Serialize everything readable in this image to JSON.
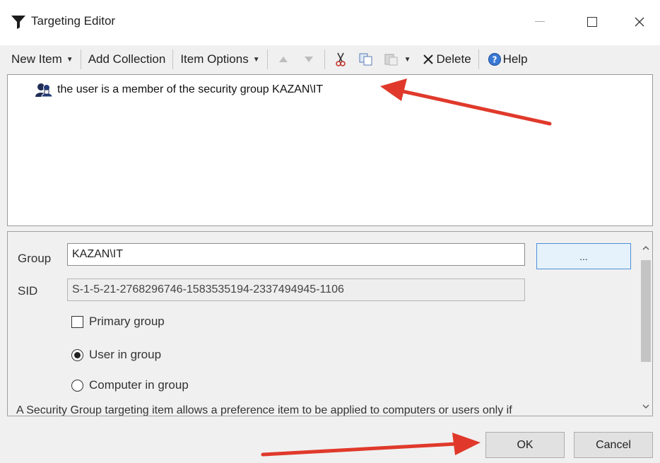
{
  "window": {
    "title": "Targeting Editor",
    "icon": "filter-funnel-icon"
  },
  "toolbar": {
    "new_item": "New Item",
    "add_collection": "Add Collection",
    "item_options": "Item Options",
    "delete": "Delete",
    "help": "Help"
  },
  "tree": {
    "items": [
      {
        "label": "the user is a member of the security group KAZAN\\IT",
        "icon": "security-group-icon"
      }
    ]
  },
  "properties": {
    "group_label": "Group",
    "group_value": "KAZAN\\IT",
    "browse_label": "...",
    "sid_label": "SID",
    "sid_value": "S-1-5-21-2768296746-1583535194-2337494945-1106",
    "primary_group_label": "Primary group",
    "primary_group_checked": false,
    "user_in_group_label": "User in group",
    "computer_in_group_label": "Computer in group",
    "selected_option": "User in group",
    "description": "A Security Group targeting item allows a preference item to be applied to computers or users only if"
  },
  "buttons": {
    "ok": "OK",
    "cancel": "Cancel"
  },
  "colors": {
    "annotation_arrow": "#e0392b",
    "focus_border": "#4f8fd8"
  }
}
